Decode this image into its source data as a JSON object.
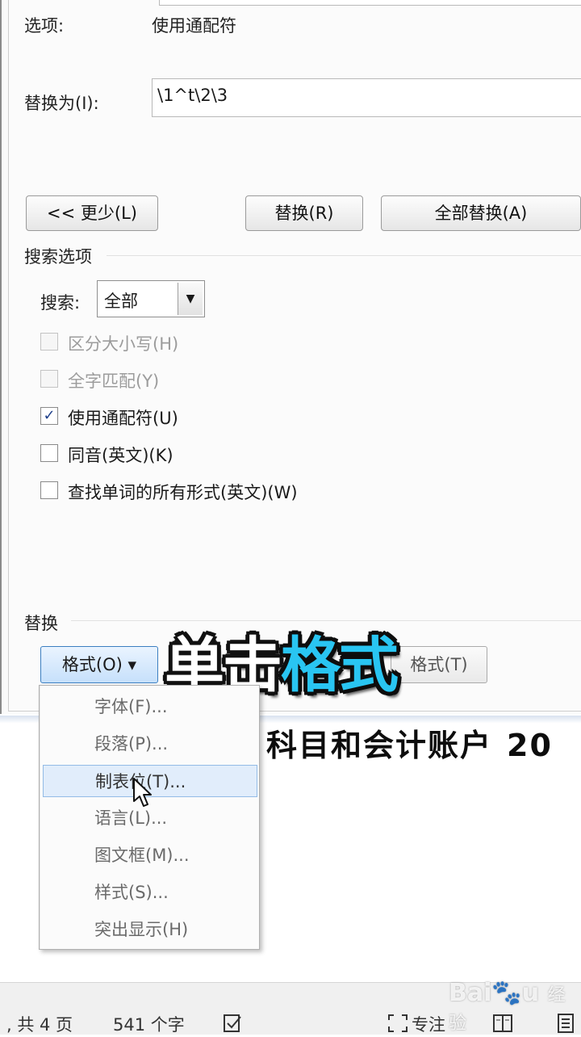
{
  "dialog": {
    "options_label": "选项:",
    "options_value": "使用通配符",
    "replace_with_label": "替换为(I):",
    "replace_with_value": "\\1^t\\2\\3",
    "buttons": {
      "less": "<< 更少(L)",
      "replace": "替换(R)",
      "replace_all": "全部替换(A)"
    },
    "search_options_title": "搜索选项",
    "search_label": "搜索:",
    "search_value": "全部",
    "checkboxes": [
      {
        "label": "区分大小写(H)",
        "checked": false,
        "disabled": true
      },
      {
        "label": "全字匹配(Y)",
        "checked": false,
        "disabled": true
      },
      {
        "label": "使用通配符(U)",
        "checked": true,
        "disabled": false
      },
      {
        "label": "同音(英文)(K)",
        "checked": false,
        "disabled": false
      },
      {
        "label": "查找单词的所有形式(英文)(W)",
        "checked": false,
        "disabled": false
      }
    ],
    "replace_section_title": "替换",
    "format_button": "格式(O) ▾",
    "no_format_button": "格式(T)"
  },
  "overlay_caption": {
    "part1": "单击",
    "part2": "格式"
  },
  "document_text": "科目和会计账户",
  "document_text_tail": "20",
  "format_menu": {
    "items": [
      "字体(F)...",
      "段落(P)...",
      "制表位(T)...",
      "语言(L)...",
      "图文框(M)...",
      "样式(S)...",
      "突出显示(H)"
    ],
    "active_index": 2
  },
  "statusbar": {
    "pages": ", 共 4 页",
    "words": "541 个字",
    "focus": "专注"
  },
  "watermark": {
    "brand": "Bai",
    "brand_end": "u",
    "suffix": "经验"
  },
  "colors": {
    "overlay_blue": "#29c5f2",
    "menu_highlight": "#e1edfb",
    "check_color": "#1e3f8a"
  }
}
